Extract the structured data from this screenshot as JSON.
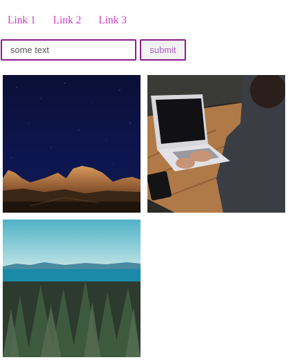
{
  "nav": {
    "links": [
      "Link 1",
      "Link 2",
      "Link 3"
    ]
  },
  "form": {
    "input_value": "some text",
    "submit_label": "submit"
  },
  "gallery": {
    "images": [
      {
        "subject": "night-sky-desert-mountains"
      },
      {
        "subject": "person-typing-on-laptop"
      },
      {
        "subject": "forest-and-lake"
      }
    ]
  },
  "colors": {
    "link": "#c93fc2",
    "border": "#8a1a8a",
    "button_text": "#b05fc5"
  }
}
